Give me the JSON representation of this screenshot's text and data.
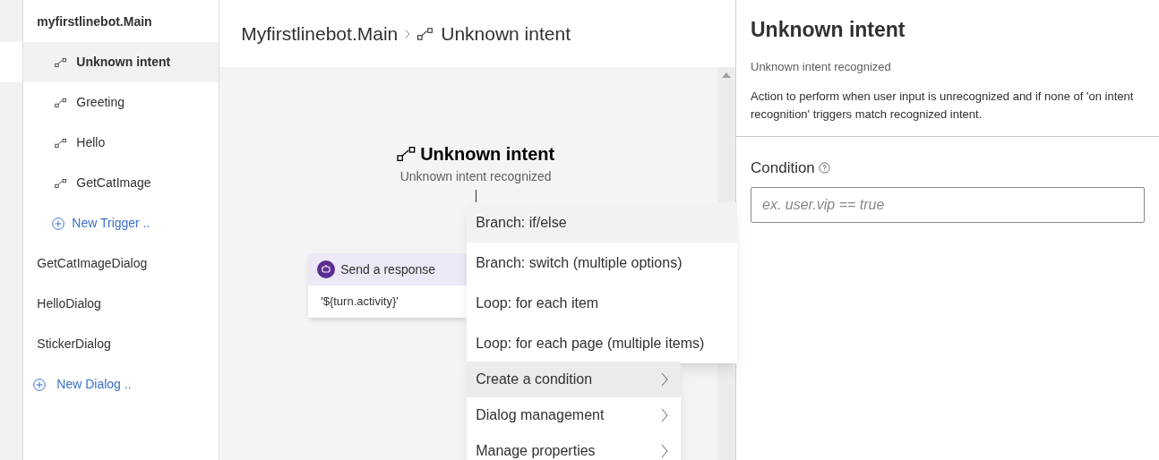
{
  "sidebar": {
    "dialogs": [
      {
        "name": "myfirstlinebot.Main",
        "selected": true,
        "triggers": [
          {
            "label": "Unknown intent",
            "selected": true
          },
          {
            "label": "Greeting",
            "selected": false
          },
          {
            "label": "Hello",
            "selected": false
          },
          {
            "label": "GetCatImage",
            "selected": false
          }
        ],
        "new_trigger": "New Trigger .."
      },
      {
        "name": "GetCatImageDialog",
        "selected": false
      },
      {
        "name": "HelloDialog",
        "selected": false
      },
      {
        "name": "StickerDialog",
        "selected": false
      }
    ],
    "new_dialog": "New Dialog .."
  },
  "breadcrumb": {
    "dialog": "Myfirstlinebot.Main",
    "trigger": "Unknown intent"
  },
  "canvas": {
    "trigger_node": {
      "title": "Unknown intent",
      "subtitle": "Unknown intent recognized"
    },
    "action_card": {
      "title": "Send a response",
      "body": "'${turn.activity}'"
    },
    "submenu": [
      {
        "label": "Branch: if/else",
        "selected": true
      },
      {
        "label": "Branch: switch (multiple options)",
        "selected": false
      },
      {
        "label": "Loop: for each item",
        "selected": false
      },
      {
        "label": "Loop: for each page (multiple items)",
        "selected": false
      }
    ],
    "menu": [
      {
        "label": "Create a condition",
        "selected": true
      },
      {
        "label": "Dialog management",
        "selected": false
      },
      {
        "label": "Manage properties",
        "selected": false
      }
    ]
  },
  "properties": {
    "title": "Unknown intent",
    "subtitle": "Unknown intent recognized",
    "description": "Action to perform when user input is unrecognized and if none of 'on intent recognition' triggers match recognized intent.",
    "condition": {
      "label": "Condition",
      "placeholder": "ex. user.vip == true"
    }
  }
}
